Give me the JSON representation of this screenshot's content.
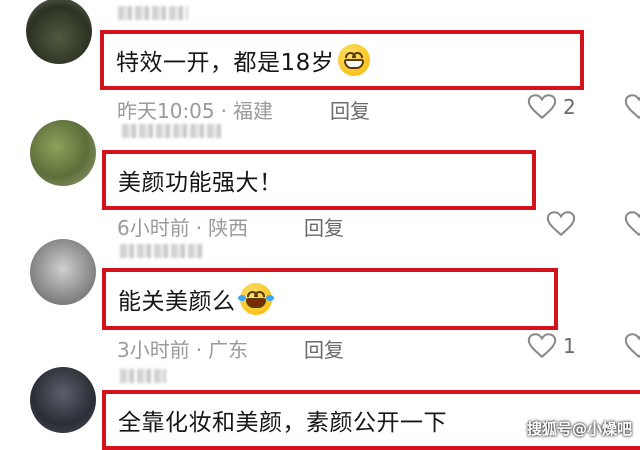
{
  "comments": [
    {
      "text": "特效一开，都是18岁",
      "emoji": "grin-icon",
      "time": "昨天10:05",
      "location": "福建",
      "reply": "回复",
      "likes": "2"
    },
    {
      "text": "美颜功能强大！",
      "emoji": "",
      "time": "6小时前",
      "location": "陕西",
      "reply": "回复",
      "likes": ""
    },
    {
      "text": "能关美颜么",
      "emoji": "laugh-cry-icon",
      "time": "3小时前",
      "location": "广东",
      "reply": "回复",
      "likes": "1"
    },
    {
      "text": "全靠化妆和美颜，素颜公开一下",
      "emoji": "",
      "time": "",
      "location": "",
      "reply": "",
      "likes": ""
    }
  ],
  "watermark": "搜狐号@小燥吧",
  "meta_separator": "·",
  "colors": {
    "highlight_border": "#d4121b",
    "meta_text": "#9a9a9a",
    "comment_text": "#161616"
  }
}
